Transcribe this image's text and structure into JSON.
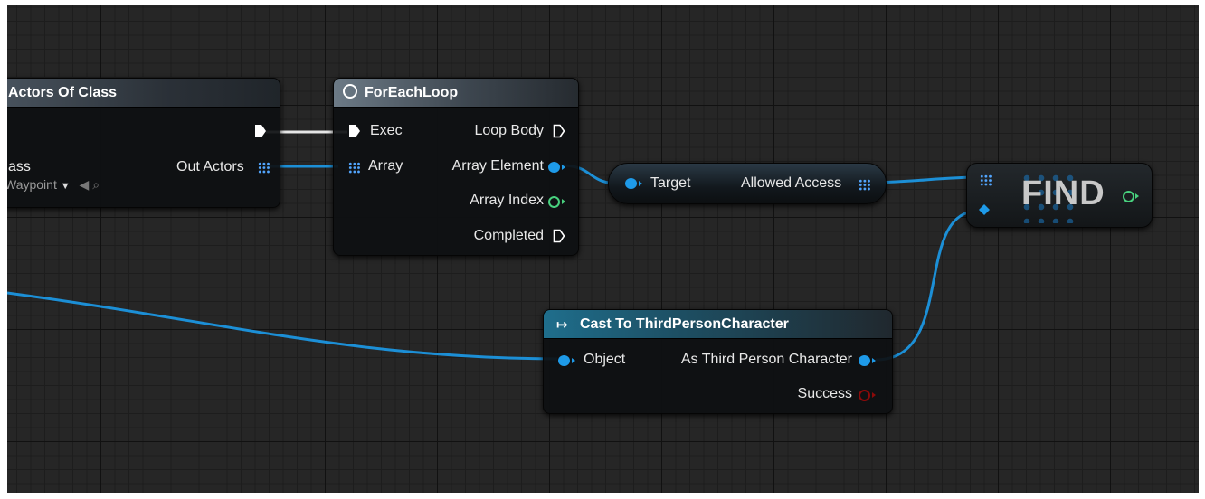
{
  "graph": {
    "node_get_actors": {
      "title": "Actors Of Class",
      "class_label": "ass",
      "class_value": "Waypoint",
      "out_actors": "Out Actors"
    },
    "node_foreach": {
      "title": "ForEachLoop",
      "exec": "Exec",
      "array": "Array",
      "loop_body": "Loop Body",
      "array_element": "Array Element",
      "array_index": "Array Index",
      "completed": "Completed"
    },
    "node_allowed_access": {
      "target": "Target",
      "allowed_access": "Allowed Access"
    },
    "node_find": {
      "title": "FIND"
    },
    "node_cast": {
      "title": "Cast To ThirdPersonCharacter",
      "object": "Object",
      "as_third_person_character": "As Third Person Character",
      "success": "Success"
    },
    "colors": {
      "object_pin": "#1e9ae8",
      "int_pin": "#48d17e",
      "bool_pin": "#8c0a0a",
      "exec_pin": "#ffffff"
    }
  }
}
